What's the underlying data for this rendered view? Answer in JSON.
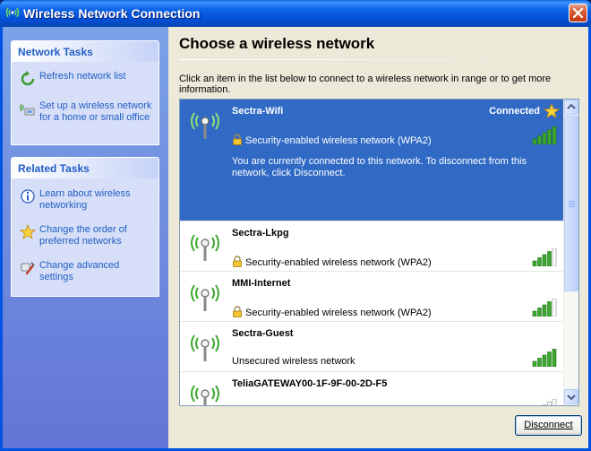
{
  "window": {
    "title": "Wireless Network Connection",
    "icons": {
      "title": "wireless-antenna-icon",
      "close": "close-icon"
    }
  },
  "network_tasks": {
    "header": "Network Tasks",
    "items": [
      {
        "label": "Refresh network list",
        "icon": "refresh-icon"
      },
      {
        "label": "Set up a wireless network for a home or small office",
        "icon": "setup-network-icon"
      }
    ]
  },
  "related_tasks": {
    "header": "Related Tasks",
    "items": [
      {
        "label": "Learn about wireless networking",
        "icon": "info-icon"
      },
      {
        "label": "Change the order of preferred networks",
        "icon": "star-icon"
      },
      {
        "label": "Change advanced settings",
        "icon": "settings-icon"
      }
    ]
  },
  "main": {
    "heading": "Choose a wireless network",
    "instruction": "Click an item in the list below to connect to a wireless network in range or to get more information."
  },
  "networks": [
    {
      "ssid": "Sectra-Wifi",
      "security": "Security-enabled wireless network (WPA2)",
      "secured": true,
      "status": "Connected",
      "selected": true,
      "signal_bars": 5,
      "message": "You are currently connected to this network. To disconnect from this network, click Disconnect."
    },
    {
      "ssid": "Sectra-Lkpg",
      "security": "Security-enabled wireless network (WPA2)",
      "secured": true,
      "signal_bars": 4
    },
    {
      "ssid": "MMI-Internet",
      "security": "Security-enabled wireless network (WPA2)",
      "secured": true,
      "signal_bars": 4
    },
    {
      "ssid": "Sectra-Guest",
      "security": "Unsecured wireless network",
      "secured": false,
      "signal_bars": 5
    },
    {
      "ssid": "TeliaGATEWAY00-1F-9F-00-2D-F5",
      "security": "",
      "secured": true,
      "signal_bars": 3
    }
  ],
  "buttons": {
    "disconnect": "Disconnect"
  },
  "colors": {
    "selection": "#316ac5",
    "link": "#215dc6",
    "signal": "#3da82f"
  }
}
